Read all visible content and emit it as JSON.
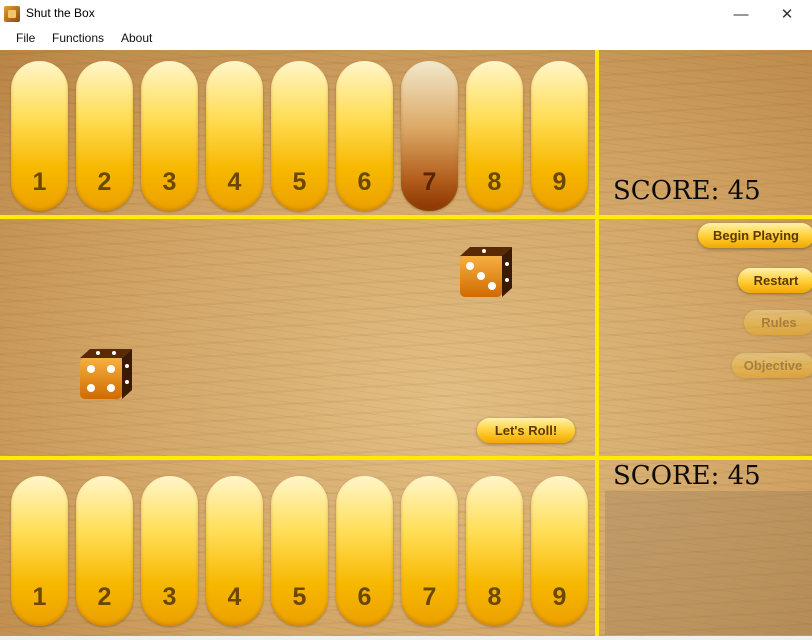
{
  "window": {
    "title": "Shut the Box",
    "minimize": "—",
    "maximize": "☐",
    "close": "✕"
  },
  "menu": {
    "file": "File",
    "functions": "Functions",
    "about": "About"
  },
  "top_tiles": [
    {
      "label": "1",
      "shut": false
    },
    {
      "label": "2",
      "shut": false
    },
    {
      "label": "3",
      "shut": false
    },
    {
      "label": "4",
      "shut": false
    },
    {
      "label": "5",
      "shut": false
    },
    {
      "label": "6",
      "shut": false
    },
    {
      "label": "7",
      "shut": true
    },
    {
      "label": "8",
      "shut": false
    },
    {
      "label": "9",
      "shut": false
    }
  ],
  "bottom_tiles": [
    {
      "label": "1",
      "shut": false
    },
    {
      "label": "2",
      "shut": false
    },
    {
      "label": "3",
      "shut": false
    },
    {
      "label": "4",
      "shut": false
    },
    {
      "label": "5",
      "shut": false
    },
    {
      "label": "6",
      "shut": false
    },
    {
      "label": "7",
      "shut": false
    },
    {
      "label": "8",
      "shut": false
    },
    {
      "label": "9",
      "shut": false
    }
  ],
  "scores": {
    "top": "SCORE: 45",
    "bottom": "SCORE: 45"
  },
  "buttons": {
    "begin": "Begin Playing",
    "restart": "Restart",
    "rules": "Rules",
    "objective": "Objective",
    "roll": "Let's Roll!"
  },
  "dice": {
    "die1": 3,
    "die2": 4
  },
  "colors": {
    "divider": "#ffea00",
    "tile": "#f7b800",
    "tile_shut": "#8a3400",
    "button": "#ffcc33"
  },
  "icons": {
    "app": "dice-box-icon"
  }
}
